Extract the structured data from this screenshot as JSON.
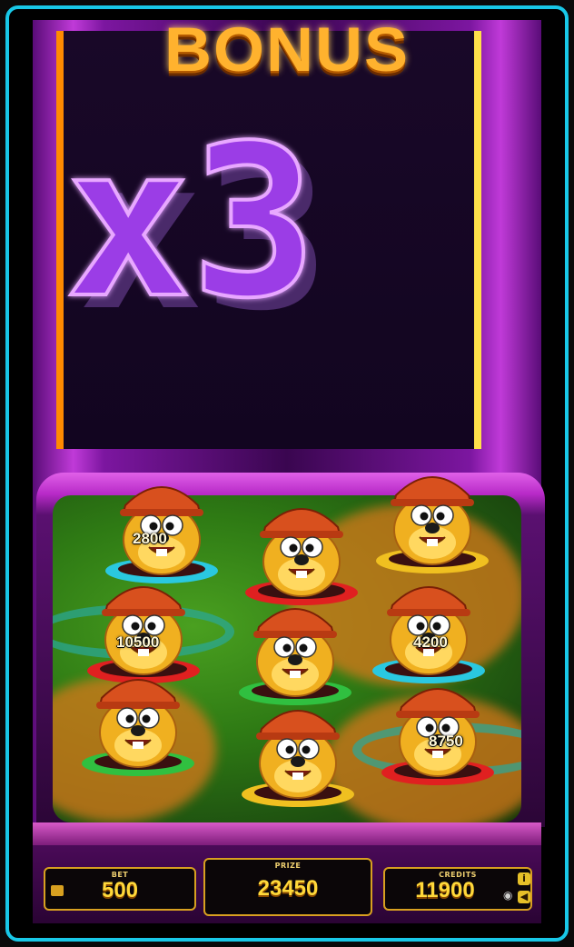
{
  "title": "BONUS",
  "multiplier": "x3",
  "moles": [
    {
      "id": "mole-1",
      "prize": "2800",
      "ring": "#2ac8e0"
    },
    {
      "id": "mole-2",
      "prize": "",
      "ring": "#e02020"
    },
    {
      "id": "mole-3",
      "prize": "",
      "ring": "#f0c020"
    },
    {
      "id": "mole-4",
      "prize": "10500",
      "ring": "#e02020"
    },
    {
      "id": "mole-5",
      "prize": "",
      "ring": "#30c040"
    },
    {
      "id": "mole-6",
      "prize": "4200",
      "ring": "#2ac8e0"
    },
    {
      "id": "mole-7",
      "prize": "",
      "ring": "#30c040"
    },
    {
      "id": "mole-8",
      "prize": "",
      "ring": "#f0c020"
    },
    {
      "id": "mole-9",
      "prize": "8750",
      "ring": "#e02020"
    }
  ],
  "panel": {
    "bet_label": "BET",
    "bet_value": "500",
    "prize_label": "PRIZE",
    "prize_value": "23450",
    "credits_label": "CREDITS",
    "credits_value": "11900"
  },
  "icons": {
    "home": "home-icon",
    "info": "info-icon",
    "sound": "sound-icon",
    "visibility": "eye-icon"
  },
  "colors": {
    "accent": "#ffb22e",
    "frame": "#18c8e8",
    "multiplier": "#9b3ce6"
  }
}
